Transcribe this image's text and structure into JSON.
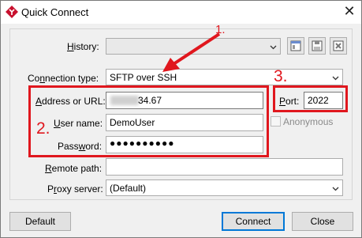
{
  "window": {
    "title": "Quick Connect",
    "close_glyph": "✕"
  },
  "history": {
    "label_prefix": "",
    "label_ul": "H",
    "label_rest": "istory:",
    "value": ""
  },
  "connection_type": {
    "label_prefix": "Co",
    "label_ul": "n",
    "label_rest": "nection type:",
    "value": "SFTP over SSH"
  },
  "address": {
    "label_prefix": "",
    "label_ul": "A",
    "label_rest": "ddress or URL:",
    "value_visible": "34.67"
  },
  "port": {
    "label_prefix": "",
    "label_ul": "P",
    "label_rest": "ort:",
    "value": "2022"
  },
  "username": {
    "label_prefix": "",
    "label_ul": "U",
    "label_rest": "ser name:",
    "value": "DemoUser"
  },
  "anonymous": {
    "label": "Anonymous",
    "checked": false
  },
  "password": {
    "label_prefix": "Pass",
    "label_ul": "w",
    "label_rest": "ord:",
    "masked_value": "●●●●●●●●●●"
  },
  "remote_path": {
    "label_prefix": "",
    "label_ul": "R",
    "label_rest": "emote path:",
    "value": ""
  },
  "proxy_server": {
    "label_prefix": "P",
    "label_ul": "r",
    "label_rest": "oxy server:",
    "value": "(Default)"
  },
  "buttons": {
    "default": "Default",
    "connect": "Connect",
    "close": "Close"
  },
  "annotations": {
    "step1": "1.",
    "step2": "2.",
    "step3": "3.",
    "color": "#e0171e"
  }
}
